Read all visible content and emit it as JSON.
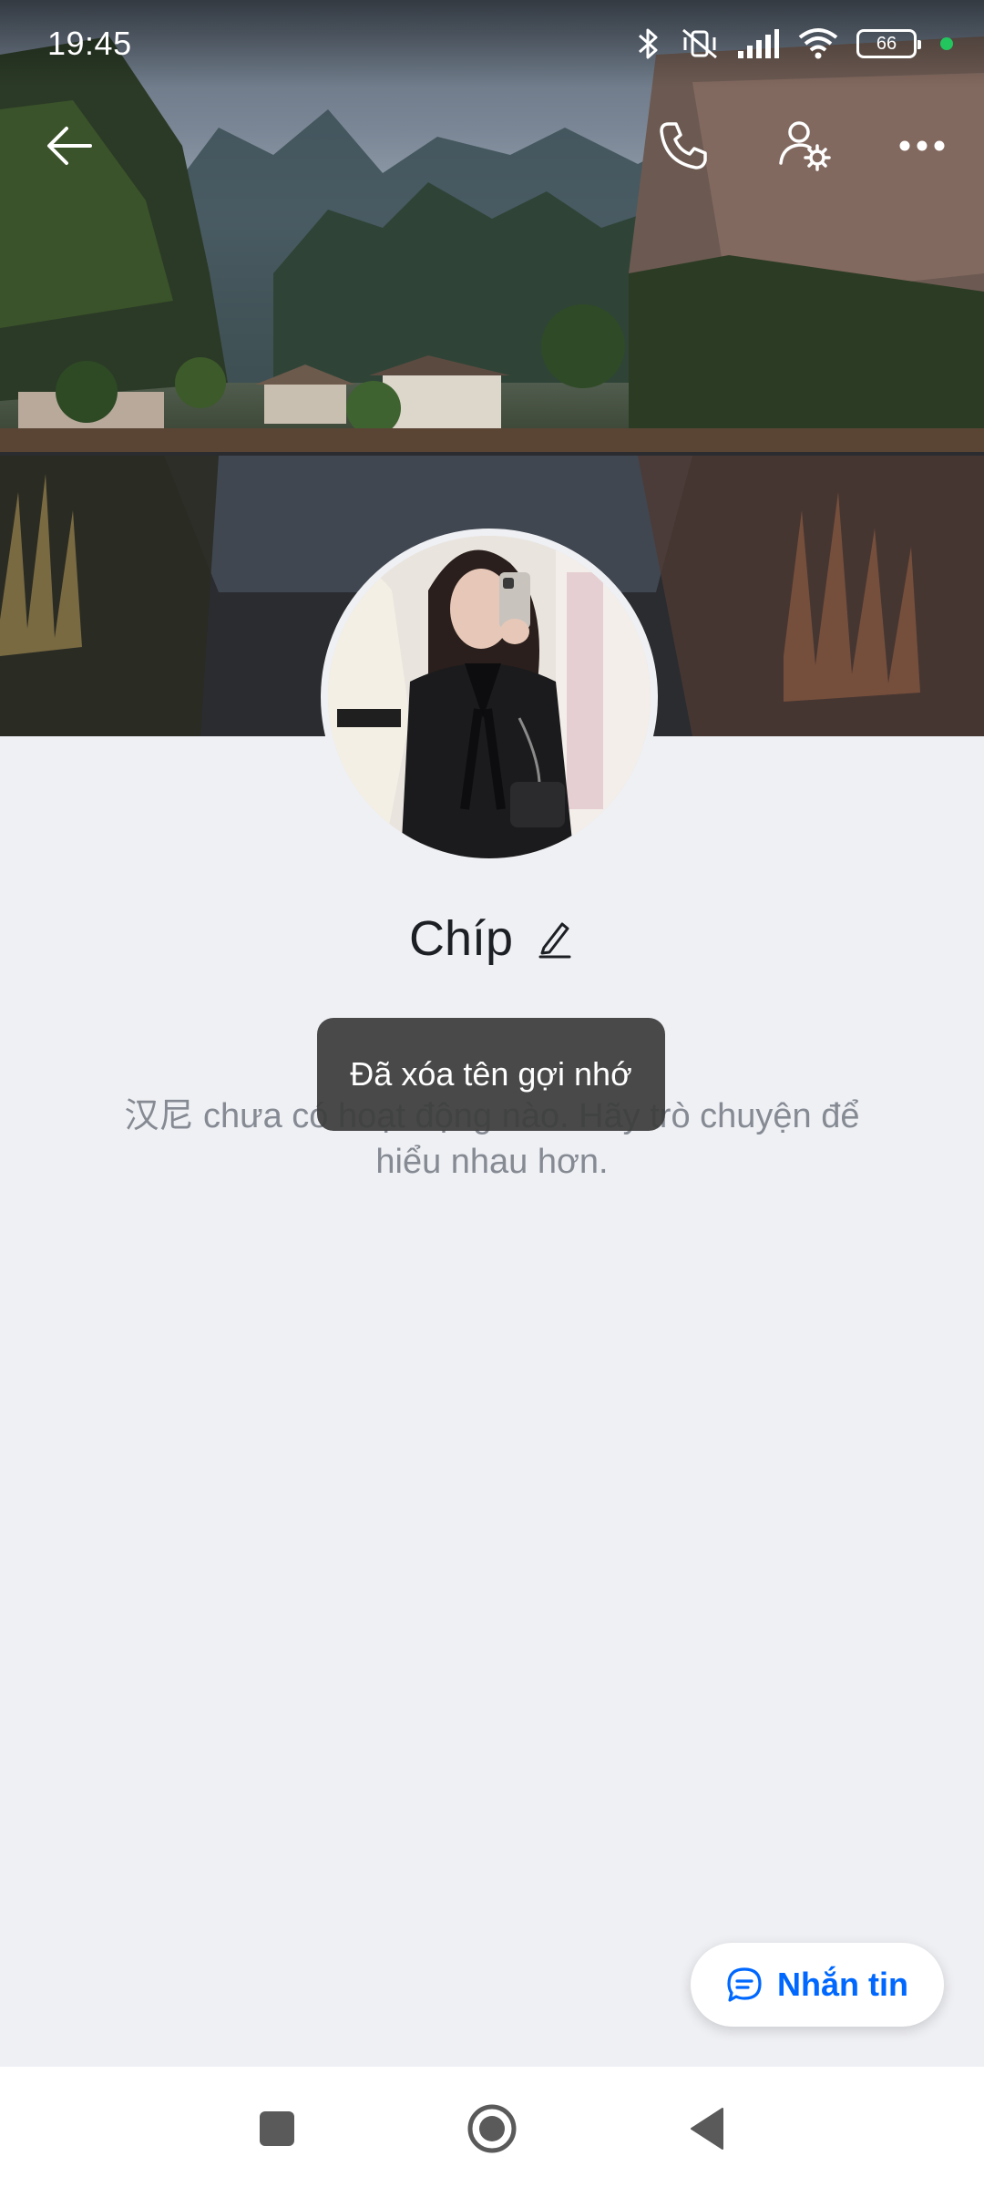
{
  "status_bar": {
    "time": "19:45",
    "battery_level": "66",
    "icons": [
      "bluetooth-icon",
      "vibrate-off-icon",
      "signal-icon",
      "wifi-icon",
      "battery-icon",
      "green-dot"
    ]
  },
  "top_bar": {
    "icons": [
      "back-arrow-icon",
      "phone-icon",
      "user-settings-icon",
      "more-dots-icon"
    ]
  },
  "profile": {
    "name": "Chíp",
    "edit_icon": "pencil-icon"
  },
  "feed": {
    "empty_text": "汉尼 chưa có hoạt động nào. Hãy trò chuyện để hiểu nhau hơn."
  },
  "toast": {
    "text": "Đã xóa tên gợi nhớ"
  },
  "message_button": {
    "label": "Nhắn tin",
    "icon": "chat-bubble-icon"
  },
  "nav_bar": {
    "icons": [
      "recents-square-icon",
      "home-circle-icon",
      "back-triangle-icon"
    ]
  },
  "colors": {
    "accent": "#0068ff",
    "background": "#eff0f4",
    "toast_bg": "#3c3c3c"
  }
}
